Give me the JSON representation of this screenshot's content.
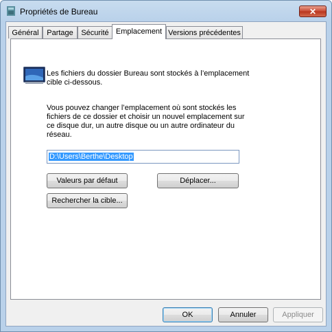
{
  "window": {
    "title": "Propriétés de Bureau",
    "close_label": "✕"
  },
  "tabs": [
    {
      "label": "Général"
    },
    {
      "label": "Partage"
    },
    {
      "label": "Sécurité"
    },
    {
      "label": "Emplacement"
    },
    {
      "label": "Versions précédentes"
    }
  ],
  "content": {
    "description": "Les fichiers du dossier Bureau sont stockés à l’emplacement cible ci-dessous.",
    "info": "Vous pouvez changer l’emplacement où sont stockés les fichiers de ce dossier et choisir un nouvel emplacement sur ce disque dur, un autre disque ou un autre ordinateur du réseau.",
    "path_value": "D:\\Users\\Berthe\\Desktop",
    "defaults_label": "Valeurs par défaut",
    "move_label": "Déplacer...",
    "find_target_label": "Rechercher la cible..."
  },
  "footer": {
    "ok_label": "OK",
    "cancel_label": "Annuler",
    "apply_label": "Appliquer"
  },
  "icons": {
    "title": "folder-properties-icon",
    "content": "desktop-folder-icon"
  },
  "colors": {
    "selection": "#3399ff",
    "close_button": "#c74a33",
    "frame": "#b9d1ea"
  }
}
